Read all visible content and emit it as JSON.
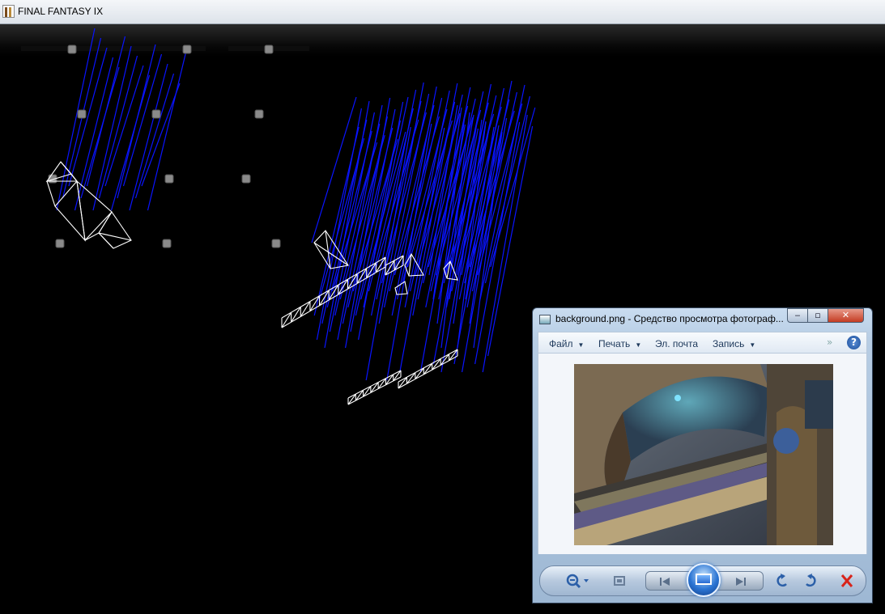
{
  "game_window": {
    "title": "FINAL FANTASY IX",
    "icon": "game-app-icon"
  },
  "photo_viewer": {
    "title": "background.png - Средство просмотра фотограф...",
    "icon": "photo-viewer-app-icon",
    "caption_buttons": {
      "minimize": "‒",
      "maximize": "▫",
      "close": "✕"
    },
    "menu": [
      {
        "label": "Файл",
        "has_dropdown": true
      },
      {
        "label": "Печать",
        "has_dropdown": true
      },
      {
        "label": "Эл. почта",
        "has_dropdown": false
      },
      {
        "label": "Запись",
        "has_dropdown": true
      }
    ],
    "menu_more_glyph": "»",
    "help_glyph": "?",
    "toolbar_icons": [
      "zoom-icon",
      "actual-size-icon",
      "previous-icon",
      "slideshow-icon",
      "next-icon",
      "rotate-left-icon",
      "rotate-right-icon",
      "delete-icon"
    ]
  },
  "colors": {
    "wireframe_blue": "#0a14ff",
    "wireframe_white": "#ffffff",
    "close_red": "#c43b22",
    "accent_blue": "#2a74d3"
  }
}
